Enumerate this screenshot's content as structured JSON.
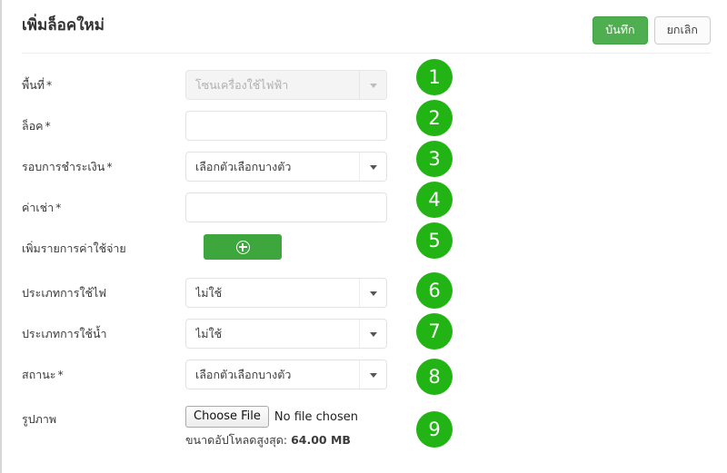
{
  "header": {
    "title": "เพิ่มล็อคใหม่",
    "save_label": "บันทึก",
    "cancel_label": "ยกเลิก"
  },
  "form": {
    "rows": [
      {
        "label": "พื้นที่",
        "required": "*",
        "type": "select",
        "value": "โซนเครื่องใช้ไฟฟ้า",
        "disabled": true,
        "badge": "1"
      },
      {
        "label": "ล็อค",
        "required": "*",
        "type": "text",
        "value": "",
        "placeholder": "",
        "badge": "2"
      },
      {
        "label": "รอบการชำระเงิน",
        "required": "*",
        "type": "select",
        "value": "เลือกตัวเลือกบางตัว",
        "disabled": false,
        "badge": "3"
      },
      {
        "label": "ค่าเช่า",
        "required": "*",
        "type": "text",
        "value": "",
        "placeholder": "",
        "badge": "4"
      },
      {
        "label": "เพิ่มรายการค่าใช้จ่าย",
        "required": "",
        "type": "add-button",
        "value": "",
        "badge": "5"
      },
      {
        "label": "ประเภทการใช้ไฟ",
        "required": "",
        "type": "select",
        "value": "ไม่ใช้",
        "disabled": false,
        "badge": "6"
      },
      {
        "label": "ประเภทการใช้น้ำ",
        "required": "",
        "type": "select",
        "value": "ไม่ใช้",
        "disabled": false,
        "badge": "7"
      },
      {
        "label": "สถานะ",
        "required": "*",
        "type": "select",
        "value": "เลือกตัวเลือกบางตัว",
        "disabled": false,
        "badge": "8"
      },
      {
        "label": "รูปภาพ",
        "required": "",
        "type": "file",
        "choose_label": "Choose File",
        "file_status": "No file chosen",
        "hint_prefix": "ขนาดอัปโหลดสูงสุด: ",
        "hint_value": "64.00 MB",
        "badge": "9"
      }
    ]
  },
  "colors": {
    "badge_green": "#22b314",
    "save_green": "#4fae4f",
    "add_green": "#3da63d"
  }
}
